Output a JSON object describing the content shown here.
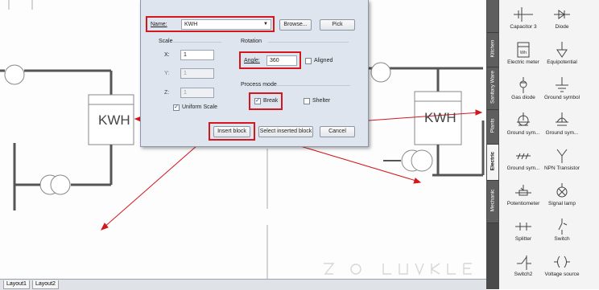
{
  "dialog": {
    "name_label": "Name:",
    "name_value": "KWH",
    "browse_label": "Browse...",
    "pick_label": "Pick",
    "scale_title": "Scale",
    "rotation_title": "Rotation",
    "x_label": "X:",
    "x_value": "1",
    "y_label": "Y:",
    "y_value": "1",
    "z_label": "Z:",
    "z_value": "1",
    "uniform_label": "Uniform Scale",
    "angle_label": "Angle:",
    "angle_value": "360",
    "aligned_label": "Aligned",
    "process_title": "Process mode",
    "break_label": "Break",
    "shelter_label": "Shelter",
    "insert_label": "Insert block",
    "select_inserted_label": "Select inserted block",
    "cancel_label": "Cancel",
    "uniform_checked": true,
    "break_checked": true,
    "aligned_checked": false,
    "shelter_checked": false
  },
  "drawing": {
    "kwh_left": "KWH",
    "kwh_right": "KWH"
  },
  "palette": {
    "tabs": [
      "Kitchen",
      "Sanitary Ware",
      "Plants",
      "Electric",
      "Mechanic"
    ],
    "active_tab": "Electric",
    "items": [
      {
        "label": "Capacitor 3",
        "icon": "capacitor-icon"
      },
      {
        "label": "Diode",
        "icon": "diode-icon"
      },
      {
        "label": "Electric meter",
        "icon": "electric-meter-icon"
      },
      {
        "label": "Equipotential",
        "icon": "equipotential-icon"
      },
      {
        "label": "Gas diode",
        "icon": "gas-diode-icon"
      },
      {
        "label": "Ground symbol",
        "icon": "ground-symbol-icon"
      },
      {
        "label": "Ground sym...",
        "icon": "ground-symbol-2-icon"
      },
      {
        "label": "Ground sym...",
        "icon": "ground-symbol-3-icon"
      },
      {
        "label": "Ground sym...",
        "icon": "ground-symbol-4-icon"
      },
      {
        "label": "NPN Transistor",
        "icon": "npn-transistor-icon"
      },
      {
        "label": "Potentiometer",
        "icon": "potentiometer-icon"
      },
      {
        "label": "Signal lamp",
        "icon": "signal-lamp-icon"
      },
      {
        "label": "Splitter",
        "icon": "splitter-icon"
      },
      {
        "label": "Switch",
        "icon": "switch-icon"
      },
      {
        "label": "Switch2",
        "icon": "switch2-icon"
      },
      {
        "label": "Voltage source",
        "icon": "voltage-source-icon"
      }
    ],
    "meter_icon_text": "Wh"
  },
  "layout_tabs": [
    "Layout1",
    "Layout2"
  ],
  "colors": {
    "highlight": "#d3171c",
    "panel_dark": "#4a4a4a",
    "dialog_bg": "#dfe5ee"
  }
}
